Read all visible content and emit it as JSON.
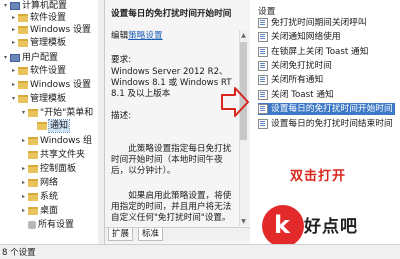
{
  "tree": {
    "items": [
      {
        "label": "计算机配置",
        "icon": "computer"
      },
      {
        "label": "软件设置",
        "icon": "folder"
      },
      {
        "label": "Windows 设置",
        "icon": "folder"
      },
      {
        "label": "管理模板",
        "icon": "folder"
      },
      {
        "label": "用户配置",
        "icon": "computer"
      },
      {
        "label": "软件设置",
        "icon": "folder"
      },
      {
        "label": "Windows 设置",
        "icon": "folder"
      },
      {
        "label": "管理模板",
        "icon": "folder"
      },
      {
        "label": "\"开始\"菜单和",
        "icon": "folder"
      },
      {
        "label": "通知",
        "icon": "folder"
      },
      {
        "label": "Windows 组",
        "icon": "folder"
      },
      {
        "label": "共享文件夹",
        "icon": "folder"
      },
      {
        "label": "控制面板",
        "icon": "folder"
      },
      {
        "label": "网络",
        "icon": "folder"
      },
      {
        "label": "系统",
        "icon": "folder"
      },
      {
        "label": "桌面",
        "icon": "folder"
      },
      {
        "label": "所有设置",
        "icon": "gear"
      }
    ]
  },
  "description": {
    "title": "设置每日的免打扰时间开始时间",
    "edit_prefix": "编辑",
    "edit_link": "策略设置",
    "requirements_label": "要求:",
    "requirements_text": "Windows Server 2012 R2、Windows 8.1 或 Windows RT 8.1 及以上版本",
    "description_label": "描述:",
    "para1": "此策略设置指定每日免打扰时间开始时间（本地时间午夜后，以分钟计）。",
    "para2": "如果启用此策略设置，将使用指定的时间，并且用户将无法自定义任何\"免打扰时间\"设置。"
  },
  "tabs": [
    "扩展",
    "标准"
  ],
  "status": {
    "count_text": "8 个设置"
  },
  "list": {
    "header": "设置",
    "items": [
      "免打扰时间期间关闭呼叫",
      "关闭通知网络使用",
      "在锁屏上关闭 Toast 通知",
      "关闭免打扰时间",
      "关闭所有通知",
      "关闭 Toast 通知",
      "设置每日的免打扰时间开始时间",
      "设置每日的免打扰时间结束时间"
    ],
    "selected_index": 6
  },
  "annotation": {
    "text": "双击打开",
    "color": "#d9261c"
  },
  "watermark": {
    "text": "好点吧",
    "glyph": "k"
  }
}
